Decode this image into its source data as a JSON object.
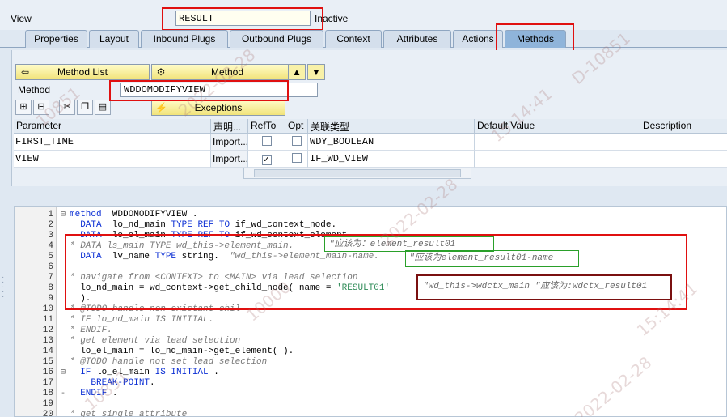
{
  "view": {
    "label": "View",
    "name": "RESULT",
    "status": "Inactive"
  },
  "tabs": [
    {
      "label": "Properties"
    },
    {
      "label": "Layout"
    },
    {
      "label": "Inbound Plugs"
    },
    {
      "label": "Outbound Plugs"
    },
    {
      "label": "Context"
    },
    {
      "label": "Attributes"
    },
    {
      "label": "Actions"
    },
    {
      "label": "Methods"
    }
  ],
  "toolbar": {
    "method_list": "Method List",
    "method": "Method",
    "exceptions": "Exceptions"
  },
  "method": {
    "label": "Method",
    "name": "WDDOMODIFYVIEW"
  },
  "params": {
    "headers": [
      "Parameter",
      "声明...",
      "RefTo",
      "Opt",
      "关联类型",
      "Default Value",
      "Description"
    ],
    "rows": [
      {
        "name": "FIRST_TIME",
        "decl": "Import...",
        "refto": false,
        "opt": false,
        "type": "WDY_BOOLEAN"
      },
      {
        "name": "VIEW",
        "decl": "Import...",
        "refto": true,
        "opt": false,
        "type": "IF_WD_VIEW"
      }
    ]
  },
  "code_lines": [
    {
      "n": "1",
      "fold": "⊟",
      "parts": [
        [
          "kw",
          "method"
        ],
        [
          "",
          "  WDDOMODIFYVIEW ."
        ]
      ]
    },
    {
      "n": "2",
      "fold": "",
      "parts": [
        [
          "",
          "  "
        ],
        [
          "kw",
          "DATA"
        ],
        [
          "",
          "  lo_nd_main "
        ],
        [
          "kw",
          "TYPE REF TO"
        ],
        [
          "",
          " if_wd_context_node."
        ]
      ]
    },
    {
      "n": "3",
      "fold": "",
      "parts": [
        [
          "",
          "  "
        ],
        [
          "kw",
          "DATA"
        ],
        [
          "",
          "  lo_el_main "
        ],
        [
          "kw",
          "TYPE REF TO"
        ],
        [
          "",
          " if_wd_context_element."
        ]
      ]
    },
    {
      "n": "4",
      "fold": "",
      "parts": [
        [
          "cm",
          "* DATA ls_main TYPE wd_this->element_main."
        ]
      ]
    },
    {
      "n": "5",
      "fold": "",
      "parts": [
        [
          "",
          "  "
        ],
        [
          "kw",
          "DATA"
        ],
        [
          "",
          "  lv_name "
        ],
        [
          "kw",
          "TYPE"
        ],
        [
          "",
          " string.  "
        ],
        [
          "cm",
          "\"wd_this->element_main-name."
        ]
      ]
    },
    {
      "n": "6",
      "fold": "",
      "parts": [
        [
          "",
          ""
        ]
      ]
    },
    {
      "n": "7",
      "fold": "",
      "parts": [
        [
          "cm",
          "* navigate from <CONTEXT> to <MAIN> via lead selection"
        ]
      ]
    },
    {
      "n": "8",
      "fold": "",
      "parts": [
        [
          "",
          "  lo_nd_main = wd_context->get_child_node( name = "
        ],
        [
          "st",
          "'RESULT01'"
        ]
      ]
    },
    {
      "n": "9",
      "fold": "",
      "parts": [
        [
          "",
          "  )."
        ]
      ]
    },
    {
      "n": "10",
      "fold": "",
      "parts": [
        [
          "cm",
          "* @TODO handle non existant chil"
        ]
      ]
    },
    {
      "n": "11",
      "fold": "",
      "parts": [
        [
          "cm",
          "* IF lo_nd_main IS INITIAL."
        ]
      ]
    },
    {
      "n": "12",
      "fold": "",
      "parts": [
        [
          "cm",
          "* ENDIF."
        ]
      ]
    },
    {
      "n": "13",
      "fold": "",
      "parts": [
        [
          "cm",
          "* get element via lead selection"
        ]
      ]
    },
    {
      "n": "14",
      "fold": "",
      "parts": [
        [
          "",
          "  lo_el_main = lo_nd_main->get_element( )."
        ]
      ]
    },
    {
      "n": "15",
      "fold": "",
      "parts": [
        [
          "cm",
          "* @TODO handle not set lead selection"
        ]
      ]
    },
    {
      "n": "16",
      "fold": "⊟",
      "parts": [
        [
          "",
          "  "
        ],
        [
          "kw",
          "IF"
        ],
        [
          "",
          " lo_el_main "
        ],
        [
          "kw",
          "IS INITIAL"
        ],
        [
          "",
          " ."
        ]
      ]
    },
    {
      "n": "17",
      "fold": "",
      "parts": [
        [
          "",
          "    "
        ],
        [
          "kw",
          "BREAK-POINT"
        ],
        [
          "",
          "."
        ]
      ]
    },
    {
      "n": "18",
      "fold": "-",
      "parts": [
        [
          "",
          "  "
        ],
        [
          "kw",
          "ENDIF"
        ],
        [
          "",
          " ."
        ]
      ]
    },
    {
      "n": "19",
      "fold": "",
      "parts": [
        [
          "",
          ""
        ]
      ]
    },
    {
      "n": "20",
      "fold": "",
      "parts": [
        [
          "cm",
          "* get single attribute"
        ]
      ]
    }
  ],
  "annotations": {
    "a1": "\"应该为：element_result01",
    "a2": "\"应该为element_result01-name",
    "a3": "\"wd_this->wdctx_main \"应该为:wdctx_result01"
  },
  "watermarks": [
    "10851",
    "2022-02-28",
    "15:14:41",
    "D-10851",
    "10000"
  ]
}
